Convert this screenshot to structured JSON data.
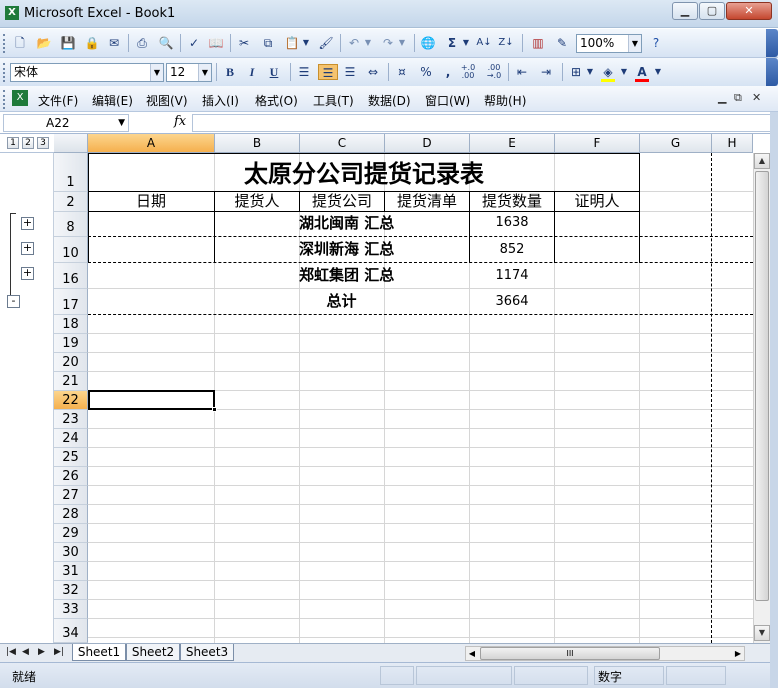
{
  "window": {
    "title": "Microsoft Excel - Book1",
    "app_icon": "excel-icon",
    "controls": [
      "minimize",
      "maximize",
      "close"
    ]
  },
  "standard_toolbar": {
    "icons": [
      "new-icon",
      "open-icon",
      "save-icon",
      "permission-icon",
      "email-icon",
      "print-icon",
      "print-preview-icon",
      "spelling-icon",
      "research-icon",
      "cut-icon",
      "copy-icon",
      "paste-icon",
      "format-painter-icon",
      "undo-icon",
      "redo-icon",
      "hyperlink-icon",
      "autosum-icon",
      "sort-ascending-icon",
      "sort-descending-icon",
      "chart-wizard-icon",
      "drawing-icon",
      "help-icon"
    ],
    "zoom": "100%"
  },
  "formatting_toolbar": {
    "font_name": "宋体",
    "font_size": "12",
    "bold": "B",
    "italic": "I",
    "underline": "U",
    "percent": "%",
    "comma": ",",
    "increase_decimal": "+.0\n.00",
    "decrease_decimal": ".00\n→.0",
    "fill_color": "#ffff00",
    "font_color": "#ff0000",
    "font_color_label": "A"
  },
  "menu": {
    "items": [
      "文件(F)",
      "编辑(E)",
      "视图(V)",
      "插入(I)",
      "格式(O)",
      "工具(T)",
      "数据(D)",
      "窗口(W)",
      "帮助(H)"
    ]
  },
  "formula_bar": {
    "name_box": "A22",
    "fx_label": "fx",
    "content": ""
  },
  "outline": {
    "levels": [
      "1",
      "2",
      "3"
    ],
    "expand_label": "+",
    "collapse_label": "-"
  },
  "columns": [
    "A",
    "B",
    "C",
    "D",
    "E",
    "F",
    "G",
    "H"
  ],
  "active_column": "A",
  "active_row": "22",
  "rows": [
    "1",
    "2",
    "8",
    "10",
    "16",
    "17",
    "18",
    "19",
    "20",
    "21",
    "22",
    "23",
    "24",
    "25",
    "26",
    "27",
    "28",
    "29",
    "30",
    "31",
    "32",
    "33",
    "34"
  ],
  "sheet": {
    "title": "太原分公司提货记录表",
    "headers": {
      "date": "日期",
      "picker": "提货人",
      "company": "提货公司",
      "list": "提货清单",
      "quantity": "提货数量",
      "witness": "证明人"
    },
    "subtotals": [
      {
        "label": "湖北闽南 汇总",
        "value": "1638"
      },
      {
        "label": "深圳新海 汇总",
        "value": "852"
      },
      {
        "label": "郑虹集团 汇总",
        "value": "1174"
      }
    ],
    "grand_total": {
      "label": "总计",
      "value": "3664"
    }
  },
  "tabs": [
    "Sheet1",
    "Sheet2",
    "Sheet3"
  ],
  "active_tab": "Sheet1",
  "status": {
    "ready": "就绪",
    "mode": "数字"
  }
}
